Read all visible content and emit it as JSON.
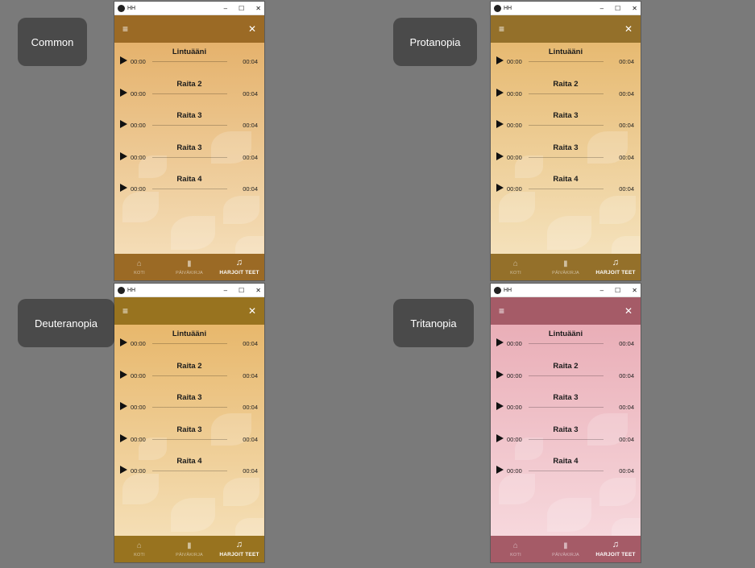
{
  "window": {
    "title": "HH",
    "minimize": "–",
    "maximize": "☐",
    "close": "✕"
  },
  "appbar": {
    "menu_icon": "≡",
    "close_icon": "✕"
  },
  "tracks": [
    {
      "title": "Lintuääni",
      "current": "00:00",
      "duration": "00:04"
    },
    {
      "title": "Raita 2",
      "current": "00:00",
      "duration": "00:04"
    },
    {
      "title": "Raita 3",
      "current": "00:00",
      "duration": "00:04"
    },
    {
      "title": "Raita 3",
      "current": "00:00",
      "duration": "00:04"
    },
    {
      "title": "Raita 4",
      "current": "00:00",
      "duration": "00:04"
    }
  ],
  "bottom_nav": [
    {
      "label": "KOTI",
      "icon": "home-icon",
      "glyph": "⌂",
      "active": false
    },
    {
      "label": "PÄIVÄKIRJA",
      "icon": "book-icon",
      "glyph": "▮",
      "active": false
    },
    {
      "label": "HARJOIT TEET",
      "icon": "music-note-icon",
      "glyph": "♫",
      "active": true
    }
  ],
  "variants": [
    {
      "label": "Common",
      "appbar": "#9b6a25",
      "bottom": "#9b6a25",
      "bg_top": "#e2aa5e",
      "bg_bottom": "#f6e2c0"
    },
    {
      "label": "Protanopia",
      "appbar": "#94702a",
      "bottom": "#94702a",
      "bg_top": "#e4b263",
      "bg_bottom": "#f6e6c4"
    },
    {
      "label": "Deuteranopia",
      "appbar": "#98731f",
      "bottom": "#98731f",
      "bg_top": "#e5b05e",
      "bg_bottom": "#f6e3be"
    },
    {
      "label": "Tritanopia",
      "appbar": "#a55b67",
      "bottom": "#a55b67",
      "bg_top": "#e7a6b0",
      "bg_bottom": "#f8dde1"
    }
  ]
}
